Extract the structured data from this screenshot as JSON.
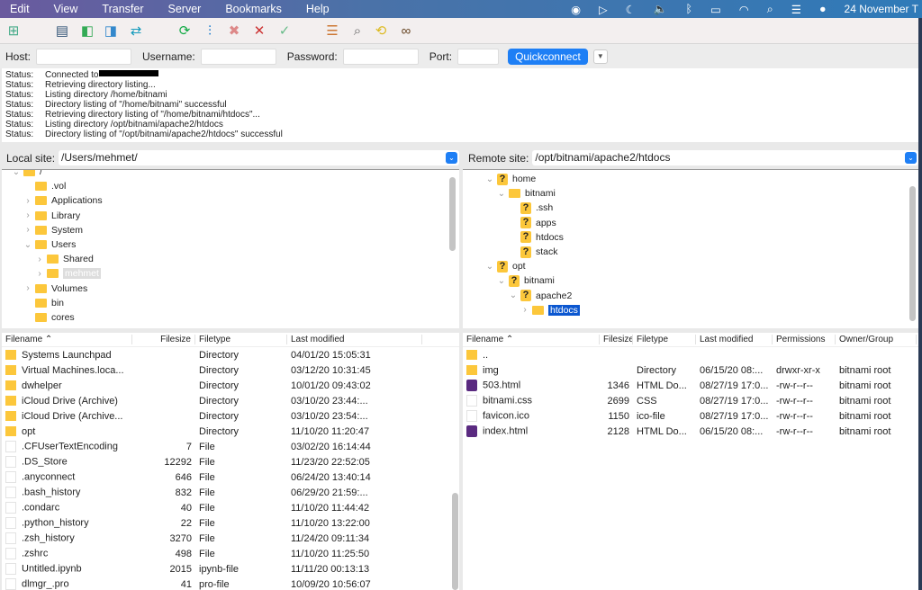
{
  "menubar": {
    "items": [
      "Edit",
      "View",
      "Transfer",
      "Server",
      "Bookmarks",
      "Help"
    ],
    "clock": "24 November T"
  },
  "toolbar": {
    "icons": [
      "site-manager-icon",
      "message-log-icon",
      "local-tree-icon",
      "remote-tree-icon",
      "transfer-queue-icon",
      "refresh-icon",
      "filter-icon",
      "cancel-icon",
      "disconnect-icon",
      "reconnect-icon",
      "compare-icon",
      "search-remote-icon",
      "sync-browse-icon",
      "find-files-icon"
    ]
  },
  "quickconnect": {
    "host_label": "Host:",
    "host": "",
    "username_label": "Username:",
    "username": "",
    "password_label": "Password:",
    "password": "",
    "port_label": "Port:",
    "port": "",
    "button": "Quickconnect"
  },
  "log": [
    {
      "k": "Status:",
      "v": "Connected to",
      "redacted": true
    },
    {
      "k": "Status:",
      "v": "Retrieving directory listing..."
    },
    {
      "k": "Status:",
      "v": "Listing directory /home/bitnami"
    },
    {
      "k": "Status:",
      "v": "Directory listing of \"/home/bitnami\" successful"
    },
    {
      "k": "Status:",
      "v": "Retrieving directory listing of \"/home/bitnami/htdocs\"..."
    },
    {
      "k": "Status:",
      "v": "Listing directory /opt/bitnami/apache2/htdocs"
    },
    {
      "k": "Status:",
      "v": "Directory listing of \"/opt/bitnami/apache2/htdocs\" successful"
    }
  ],
  "local": {
    "label": "Local site:",
    "path": "/Users/mehmet/",
    "tree": [
      {
        "name": "/",
        "depth": 0,
        "chev": "v",
        "icon": "folder"
      },
      {
        "name": ".vol",
        "depth": 1,
        "chev": "",
        "icon": "folder"
      },
      {
        "name": "Applications",
        "depth": 1,
        "chev": ">",
        "icon": "folder"
      },
      {
        "name": "Library",
        "depth": 1,
        "chev": ">",
        "icon": "folder"
      },
      {
        "name": "System",
        "depth": 1,
        "chev": ">",
        "icon": "folder"
      },
      {
        "name": "Users",
        "depth": 1,
        "chev": "v",
        "icon": "folder"
      },
      {
        "name": "Shared",
        "depth": 2,
        "chev": ">",
        "icon": "folder"
      },
      {
        "name": "mehmet",
        "depth": 2,
        "chev": ">",
        "icon": "folder",
        "selected": "gray"
      },
      {
        "name": "Volumes",
        "depth": 1,
        "chev": ">",
        "icon": "folder"
      },
      {
        "name": "bin",
        "depth": 1,
        "chev": "",
        "icon": "folder"
      },
      {
        "name": "cores",
        "depth": 1,
        "chev": "",
        "icon": "folder"
      }
    ],
    "columns": [
      "Filename",
      "Filesize",
      "Filetype",
      "Last modified"
    ],
    "files": [
      [
        "Systems Launchpad",
        "",
        "Directory",
        "04/01/20 15:05:31",
        "folder"
      ],
      [
        "Virtual Machines.loca...",
        "",
        "Directory",
        "03/12/20 10:31:45",
        "folder"
      ],
      [
        "dwhelper",
        "",
        "Directory",
        "10/01/20 09:43:02",
        "folder"
      ],
      [
        "iCloud Drive (Archive)",
        "",
        "Directory",
        "03/10/20 23:44:...",
        "folder"
      ],
      [
        "iCloud Drive (Archive...",
        "",
        "Directory",
        "03/10/20 23:54:...",
        "folder"
      ],
      [
        "opt",
        "",
        "Directory",
        "11/10/20 11:20:47",
        "folder"
      ],
      [
        ".CFUserTextEncoding",
        "7",
        "File",
        "03/02/20 16:14:44",
        "file"
      ],
      [
        ".DS_Store",
        "12292",
        "File",
        "11/23/20 22:52:05",
        "file"
      ],
      [
        ".anyconnect",
        "646",
        "File",
        "06/24/20 13:40:14",
        "file"
      ],
      [
        ".bash_history",
        "832",
        "File",
        "06/29/20 21:59:...",
        "file"
      ],
      [
        ".condarc",
        "40",
        "File",
        "11/10/20 11:44:42",
        "file"
      ],
      [
        ".python_history",
        "22",
        "File",
        "11/10/20 13:22:00",
        "file"
      ],
      [
        ".zsh_history",
        "3270",
        "File",
        "11/24/20 09:11:34",
        "file"
      ],
      [
        ".zshrc",
        "498",
        "File",
        "11/10/20 11:25:50",
        "file"
      ],
      [
        "Untitled.ipynb",
        "2015",
        "ipynb-file",
        "11/11/20 00:13:13",
        "file"
      ],
      [
        "dlmgr_.pro",
        "41",
        "pro-file",
        "10/09/20 10:56:07",
        "file"
      ]
    ]
  },
  "remote": {
    "label": "Remote site:",
    "path": "/opt/bitnami/apache2/htdocs",
    "tree": [
      {
        "name": "home",
        "depth": 0,
        "chev": "v",
        "icon": "unknown"
      },
      {
        "name": "bitnami",
        "depth": 1,
        "chev": "v",
        "icon": "folder"
      },
      {
        "name": ".ssh",
        "depth": 2,
        "chev": "",
        "icon": "unknown"
      },
      {
        "name": "apps",
        "depth": 2,
        "chev": "",
        "icon": "unknown"
      },
      {
        "name": "htdocs",
        "depth": 2,
        "chev": "",
        "icon": "unknown"
      },
      {
        "name": "stack",
        "depth": 2,
        "chev": "",
        "icon": "unknown"
      },
      {
        "name": "opt",
        "depth": 0,
        "chev": "v",
        "icon": "unknown"
      },
      {
        "name": "bitnami",
        "depth": 1,
        "chev": "v",
        "icon": "unknown"
      },
      {
        "name": "apache2",
        "depth": 2,
        "chev": "v",
        "icon": "unknown"
      },
      {
        "name": "htdocs",
        "depth": 3,
        "chev": ">",
        "icon": "folder",
        "selected": "blue"
      }
    ],
    "columns": [
      "Filename",
      "Filesize",
      "Filetype",
      "Last modified",
      "Permissions",
      "Owner/Group"
    ],
    "files": [
      [
        "..",
        "",
        "",
        "",
        "",
        "",
        "folder"
      ],
      [
        "img",
        "",
        "Directory",
        "06/15/20 08:...",
        "drwxr-xr-x",
        "bitnami root",
        "folder"
      ],
      [
        "503.html",
        "1346",
        "HTML Do...",
        "08/27/19 17:0...",
        "-rw-r--r--",
        "bitnami root",
        "html"
      ],
      [
        "bitnami.css",
        "2699",
        "CSS",
        "08/27/19 17:0...",
        "-rw-r--r--",
        "bitnami root",
        "file"
      ],
      [
        "favicon.ico",
        "1150",
        "ico-file",
        "08/27/19 17:0...",
        "-rw-r--r--",
        "bitnami root",
        "file"
      ],
      [
        "index.html",
        "2128",
        "HTML Do...",
        "06/15/20 08:...",
        "-rw-r--r--",
        "bitnami root",
        "html"
      ]
    ]
  },
  "colors": {
    "accent": "#1e7ff5",
    "selection": "#0b57d0",
    "folder": "#fcc73b"
  }
}
